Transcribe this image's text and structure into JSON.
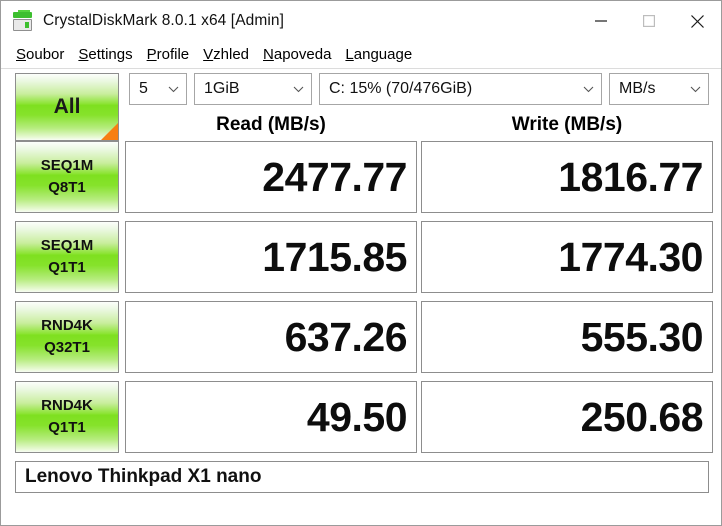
{
  "window": {
    "title": "CrystalDiskMark 8.0.1 x64 [Admin]",
    "icon": "disk-drive-icon",
    "controls": {
      "minimize": "minimize-icon",
      "maximize": "maximize-icon",
      "close": "close-icon"
    }
  },
  "menu": {
    "items": [
      {
        "accel": "S",
        "rest": "oubor"
      },
      {
        "accel": "S",
        "rest": "ettings"
      },
      {
        "accel": "P",
        "rest": "rofile"
      },
      {
        "accel": "V",
        "rest": "zhled"
      },
      {
        "accel": "N",
        "rest": "apoveda"
      },
      {
        "accel": "L",
        "rest": "anguage"
      }
    ]
  },
  "toolbar": {
    "all_button": "All",
    "test_count": "5",
    "test_size": "1GiB",
    "target_drive": "C: 15% (70/476GiB)",
    "unit": "MB/s"
  },
  "columns": {
    "read": "Read (MB/s)",
    "write": "Write (MB/s)"
  },
  "results": [
    {
      "label_line1": "SEQ1M",
      "label_line2": "Q8T1",
      "read": "2477.77",
      "write": "1816.77",
      "read_fill_pct": 72,
      "write_fill_pct": 70
    },
    {
      "label_line1": "SEQ1M",
      "label_line2": "Q1T1",
      "read": "1715.85",
      "write": "1774.30",
      "read_fill_pct": 70,
      "write_fill_pct": 68
    },
    {
      "label_line1": "RND4K",
      "label_line2": "Q32T1",
      "read": "637.26",
      "write": "555.30",
      "read_fill_pct": 63,
      "write_fill_pct": 61
    },
    {
      "label_line1": "RND4K",
      "label_line2": "Q1T1",
      "read": "49.50",
      "write": "250.68",
      "read_fill_pct": 45,
      "write_fill_pct": 39
    }
  ],
  "status": {
    "device": "Lenovo Thinkpad X1 nano"
  },
  "colors": {
    "accent_green": "#7ee01f",
    "corner_orange": "#f77f12",
    "border": "#8d8d8d",
    "text": "#111111"
  }
}
